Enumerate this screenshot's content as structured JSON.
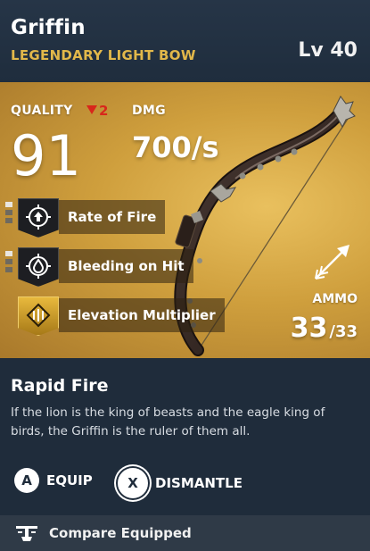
{
  "item": {
    "name": "Griffin",
    "type": "LEGENDARY LIGHT BOW",
    "level": "Lv 40"
  },
  "stats": {
    "quality_label": "QUALITY",
    "quality_delta": "2",
    "quality_value": "91",
    "dmg_label": "DMG",
    "dmg_value": "700/s"
  },
  "perks": [
    {
      "label": "Rate of Fire",
      "icon": "rate-of-fire-icon",
      "pips": 3,
      "pips_on": 1
    },
    {
      "label": "Bleeding on Hit",
      "icon": "bleeding-icon",
      "pips": 3,
      "pips_on": 1
    },
    {
      "label": "Elevation Multiplier",
      "icon": "elevation-icon",
      "pips": 0,
      "pips_on": 0
    }
  ],
  "ammo": {
    "label": "AMMO",
    "current": "33",
    "max": "/33",
    "icon": "arrow-icon"
  },
  "ability": {
    "title": "Rapid Fire",
    "description": "If the lion is the king of beasts and the eagle king of birds, the Griffin is the ruler of them all."
  },
  "actions": {
    "equip_key": "A",
    "equip_label": "EQUIP",
    "dismantle_key": "X",
    "dismantle_label": "DISMANTLE"
  },
  "footer": {
    "compare_label": "Compare Equipped",
    "icon": "compare-icon"
  },
  "colors": {
    "rarity": "#e2b84a",
    "negative": "#d8261b",
    "panel_gold": "#cf9f3d",
    "background": "#1f2c3b"
  }
}
